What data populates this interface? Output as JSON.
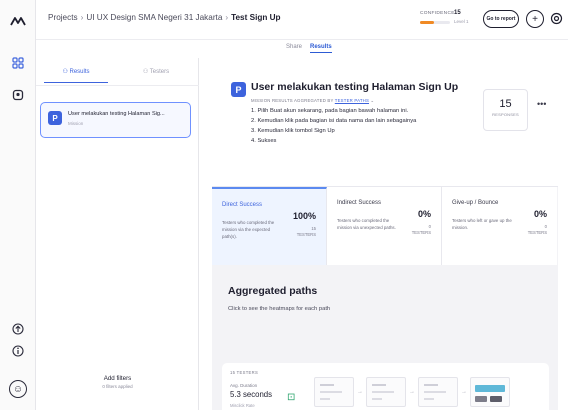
{
  "breadcrumb": {
    "root": "Projects",
    "project": "UI UX Design SMA Negeri 31 Jakarta",
    "current": "Test Sign Up"
  },
  "confidence": {
    "label": "CONFIDENCE",
    "value": "15",
    "sub": "Level 1",
    "level": 0.45,
    "color": "#f08a24"
  },
  "topbar": {
    "report_label": "Go to report",
    "add_icon": "plus-icon",
    "help_icon": "help-icon"
  },
  "subtabs": {
    "share": "Share",
    "results": "Results"
  },
  "left_panel": {
    "tab_results": "Results",
    "tab_testers": "Testers",
    "mission": {
      "badge": "P",
      "title": "User melakukan testing Halaman Sig...",
      "subtitle": "Mission"
    },
    "filters_label": "Add filters",
    "filters_sub": "0 filters applied"
  },
  "mission_header": {
    "badge": "P",
    "title": "User melakukan testing Halaman Sign Up",
    "subtitle_prefix": "MISSION RESULTS AGGREGATED BY",
    "subtitle_link": "TESTER PATHS",
    "steps": [
      "1. Pilih Buat akun sekarang, pada bagian bawah halaman ini.",
      "2. Kemudian klik pada bagian isi data nama dan lain sebagainya",
      "3. Kemudian klik tombol Sign Up",
      "4. Sukses"
    ],
    "responses_count": "15",
    "responses_label": "RESPONSES"
  },
  "metrics": [
    {
      "title": "Direct Success",
      "desc": "Testers who completed the mission via the expected path(s).",
      "pct": "100%",
      "count": "15",
      "count_lbl": "TESTERS"
    },
    {
      "title": "Indirect Success",
      "desc": "Testers who completed the mission via unexpected paths.",
      "pct": "0%",
      "count": "0",
      "count_lbl": "TESTERS"
    },
    {
      "title": "Give-up / Bounce",
      "desc": "Testers who left or gave up the mission.",
      "pct": "0%",
      "count": "0",
      "count_lbl": "TESTERS"
    }
  ],
  "aggregated": {
    "title": "Aggregated paths",
    "subtitle": "Click to see the heatmaps for each path",
    "path": {
      "testers": "15 TESTERS",
      "duration_label": "Avg. Duration",
      "duration": "5.3 seconds",
      "more": "Misclick Rate"
    }
  }
}
